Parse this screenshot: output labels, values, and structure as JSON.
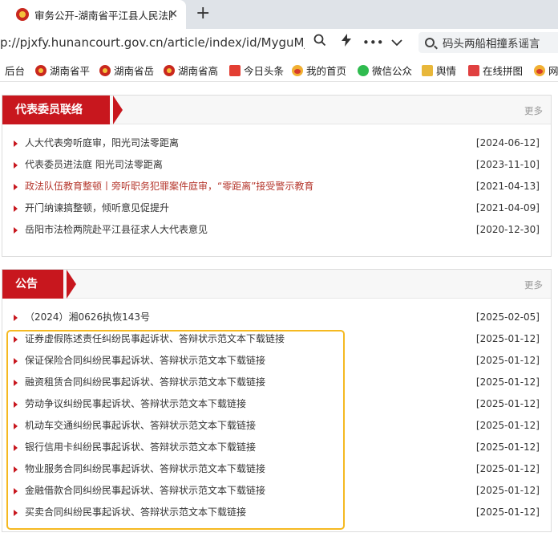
{
  "browser": {
    "tab_title": "审务公开-湖南省平江县人民法院",
    "url": "p://pjxfy.hunancourt.gov.cn/article/index/id/MyguMjAwMTAwM",
    "search_text": "码头两船相撞系谣言"
  },
  "bookmarks": [
    {
      "label": "后台",
      "icon": "none"
    },
    {
      "label": "湖南省平",
      "icon": "emblem-icon"
    },
    {
      "label": "湖南省岳",
      "icon": "emblem-icon"
    },
    {
      "label": "湖南省高",
      "icon": "emblem-icon"
    },
    {
      "label": "今日头条",
      "icon": "toutiao-icon"
    },
    {
      "label": "我的首页",
      "icon": "weibo-icon"
    },
    {
      "label": "微信公众",
      "icon": "wechat-icon"
    },
    {
      "label": "舆情",
      "icon": "folder-icon"
    },
    {
      "label": "在线拼图",
      "icon": "pinyin-icon"
    },
    {
      "label": "网",
      "icon": "weibo-icon"
    }
  ],
  "sections": [
    {
      "title": "代表委员联络",
      "more": "更多",
      "items": [
        {
          "title": "人大代表旁听庭审，阳光司法零距离",
          "date": "[2024-06-12]"
        },
        {
          "title": "代表委员进法庭 阳光司法零距离",
          "date": "[2023-11-10]"
        },
        {
          "title": "政法队伍教育整顿丨旁听职务犯罪案件庭审，“零距离”接受警示教育",
          "date": "[2021-04-13]",
          "highlight": true
        },
        {
          "title": "开门纳谏搞整顿，倾听意见促提升",
          "date": "[2021-04-09]"
        },
        {
          "title": "岳阳市法检两院赴平江县征求人大代表意见",
          "date": "[2020-12-30]"
        }
      ]
    },
    {
      "title": "公告",
      "more": "更多",
      "items": [
        {
          "title": "（2024）湘0626执恢143号",
          "date": "[2025-02-05]"
        },
        {
          "title": "证券虚假陈述责任纠纷民事起诉状、答辩状示范文本下载链接",
          "date": "[2025-01-12]"
        },
        {
          "title": "保证保险合同纠纷民事起诉状、答辩状示范文本下载链接",
          "date": "[2025-01-12]"
        },
        {
          "title": "融资租赁合同纠纷民事起诉状、答辩状示范文本下载链接",
          "date": "[2025-01-12]"
        },
        {
          "title": "劳动争议纠纷民事起诉状、答辩状示范文本下载链接",
          "date": "[2025-01-12]"
        },
        {
          "title": "机动车交通纠纷民事起诉状、答辩状示范文本下载链接",
          "date": "[2025-01-12]"
        },
        {
          "title": "银行信用卡纠纷民事起诉状、答辩状示范文本下载链接",
          "date": "[2025-01-12]"
        },
        {
          "title": "物业服务合同纠纷民事起诉状、答辩状示范文本下载链接",
          "date": "[2025-01-12]"
        },
        {
          "title": "金融借款合同纠纷民事起诉状、答辩状示范文本下载链接",
          "date": "[2025-01-12]"
        },
        {
          "title": "买卖合同纠纷民事起诉状、答辩状示范文本下载链接",
          "date": "[2025-01-12]"
        }
      ]
    }
  ],
  "colors": {
    "accent_red": "#c8171e",
    "highlight_box": "#f5b921",
    "link_highlight": "#b5372d"
  }
}
